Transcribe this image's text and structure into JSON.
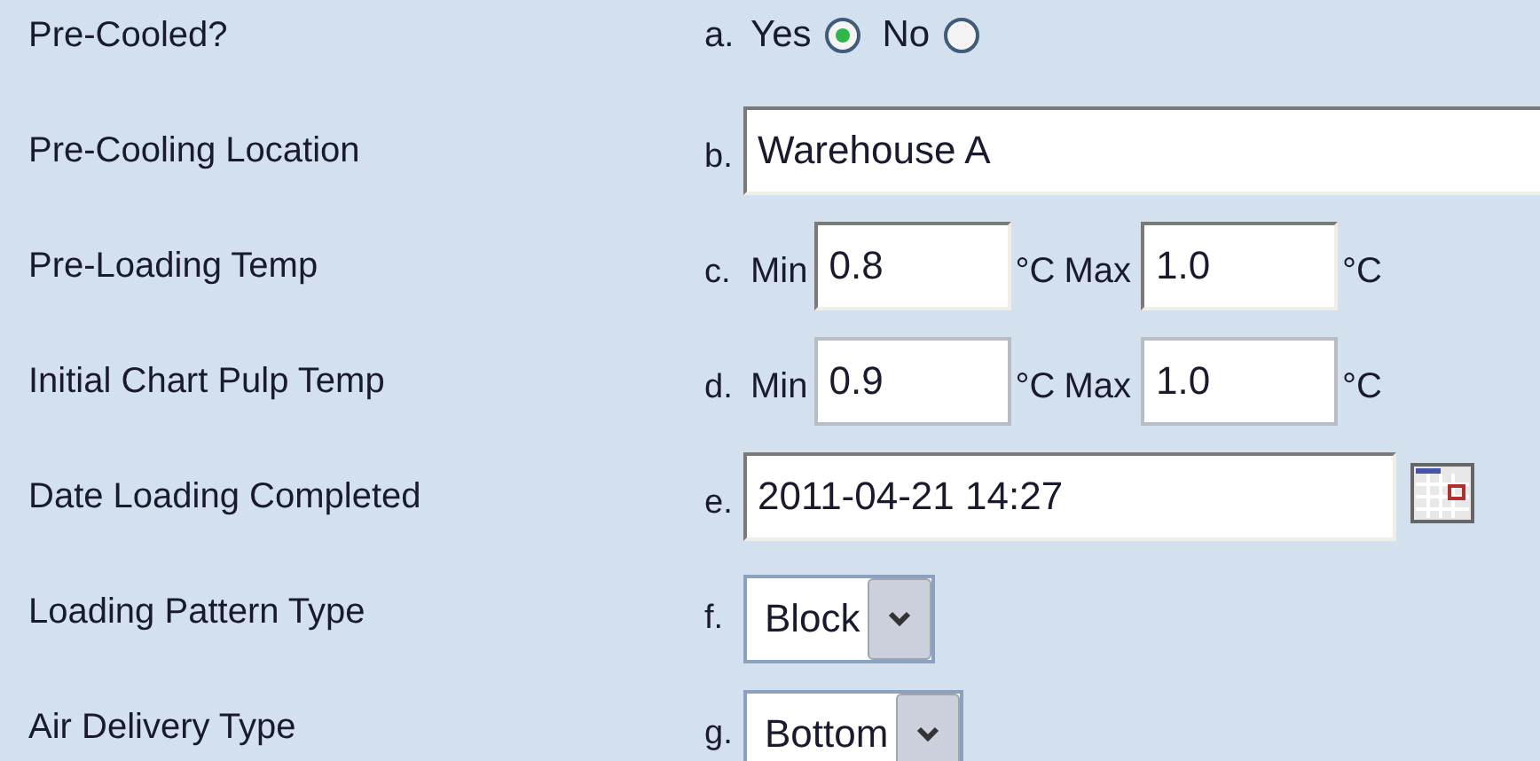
{
  "rows": [
    {
      "label": "Pre-Cooled?",
      "letter": "a.",
      "kind": "radio",
      "options": [
        {
          "label": "Yes",
          "selected": true
        },
        {
          "label": "No",
          "selected": false
        }
      ]
    },
    {
      "label": "Pre-Cooling Location",
      "letter": "b.",
      "kind": "text",
      "value": "Warehouse A"
    },
    {
      "label": "Pre-Loading Temp",
      "letter": "c.",
      "kind": "range",
      "min_label": "Min",
      "min_value": "0.8",
      "min_unit": "°C",
      "max_label": "Max",
      "max_value": "1.0",
      "max_unit": "°C"
    },
    {
      "label": "Initial Chart Pulp Temp",
      "letter": "d.",
      "kind": "range",
      "min_label": "Min",
      "min_value": "0.9",
      "min_unit": "°C",
      "max_label": "Max",
      "max_value": "1.0",
      "max_unit": "°C"
    },
    {
      "label": "Date Loading Completed",
      "letter": "e.",
      "kind": "date",
      "value": "2011-04-21 14:27"
    },
    {
      "label": "Loading Pattern Type",
      "letter": "f.",
      "kind": "select",
      "value": "Block"
    },
    {
      "label": "Air Delivery Type",
      "letter": "g.",
      "kind": "select",
      "value": "Bottom"
    }
  ]
}
